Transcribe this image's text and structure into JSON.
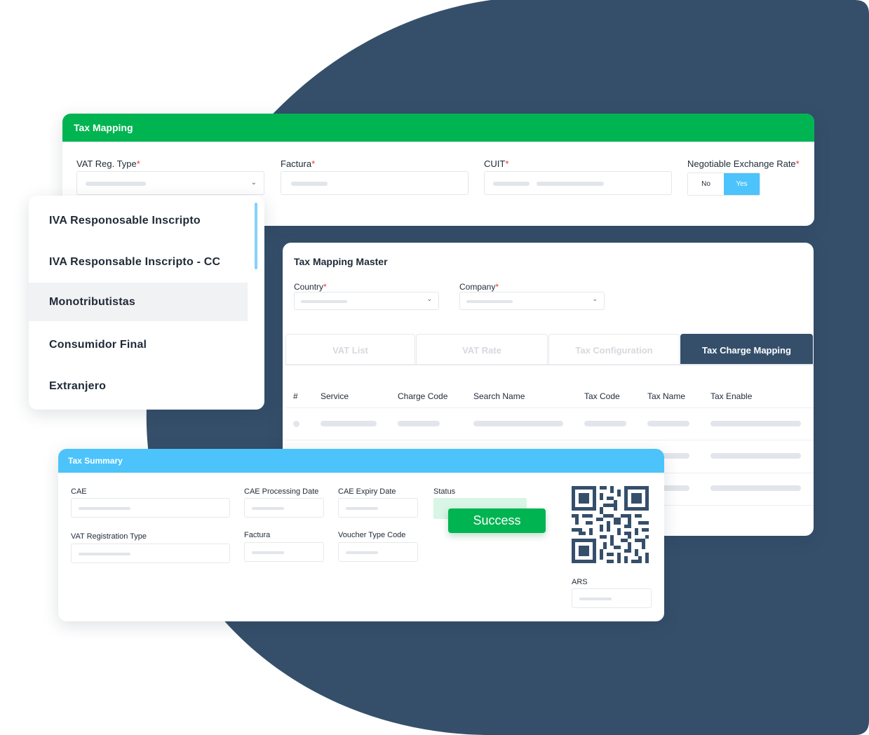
{
  "colors": {
    "navy": "#354f6b",
    "green": "#00b451",
    "light_blue": "#4cc3fa",
    "required": "#e53935"
  },
  "tax_mapping": {
    "title": "Tax Mapping",
    "fields": {
      "vat_reg_type": "VAT Reg. Type",
      "factura": "Factura",
      "cuit": "CUIT",
      "negotiable_rate": "Negotiable Exchange Rate"
    },
    "required_mark": "*",
    "toggle": {
      "no": "No",
      "yes": "Yes",
      "selected": "Yes"
    }
  },
  "vat_dropdown": {
    "items": [
      "IVA Responosable Inscripto",
      "IVA Responsable Inscripto - CC",
      "Monotributistas",
      "Consumidor Final",
      "Extranjero"
    ],
    "highlighted": "Monotributistas"
  },
  "master": {
    "title": "Tax Mapping Master",
    "country_label": "Country",
    "company_label": "Company",
    "tabs": [
      "VAT List",
      "VAT Rate",
      "Tax Configuration",
      "Tax Charge Mapping"
    ],
    "active_tab": "Tax Charge Mapping",
    "columns": [
      "#",
      "Service",
      "Charge Code",
      "Search Name",
      "Tax Code",
      "Tax Name",
      "Tax Enable"
    ]
  },
  "summary": {
    "title": "Tax Summary",
    "labels": {
      "cae": "CAE",
      "cae_processing_date": "CAE Processing Date",
      "cae_expiry_date": "CAE Expiry Date",
      "status": "Status",
      "vat_registration_type": "VAT Registration Type",
      "factura": "Factura",
      "voucher_type_code": "Voucher Type Code",
      "ars": "ARS"
    },
    "status_value": "Success"
  },
  "icons": {
    "dropdown_chevron": "chevron-down-icon",
    "qr": "qr-code-icon"
  }
}
